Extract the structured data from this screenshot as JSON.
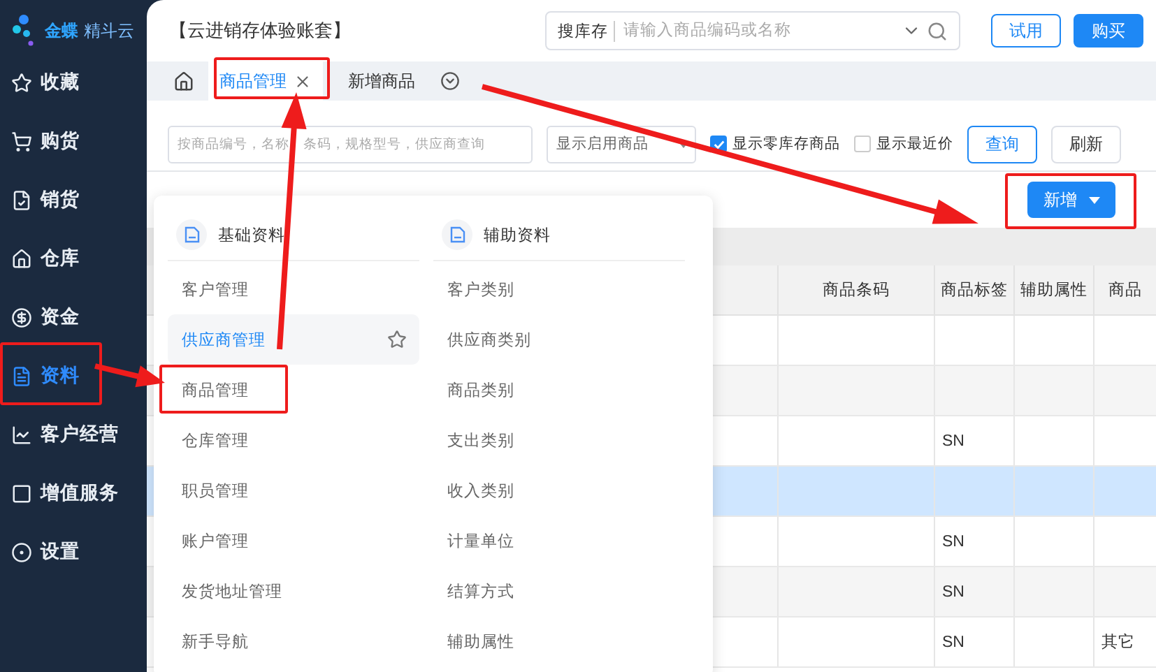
{
  "sidebar": {
    "logo": {
      "brand": "金蝶",
      "product": "精斗云"
    },
    "items": [
      {
        "label": "收藏",
        "selected": false
      },
      {
        "label": "购货",
        "selected": false
      },
      {
        "label": "销货",
        "selected": false
      },
      {
        "label": "仓库",
        "selected": false
      },
      {
        "label": "资金",
        "selected": false
      },
      {
        "label": "资料",
        "selected": true
      },
      {
        "label": "客户经营",
        "selected": false
      },
      {
        "label": "增值服务",
        "selected": false
      },
      {
        "label": "设置",
        "selected": false
      }
    ]
  },
  "header": {
    "title": "【云进销存体验账套】",
    "search": {
      "scope": "搜库存",
      "placeholder": "请输入商品编码或名称"
    },
    "buttons": [
      {
        "label": "试用",
        "kind": "outline"
      },
      {
        "label": "购买",
        "kind": "primary"
      }
    ]
  },
  "tabs": [
    {
      "label": "商品管理",
      "selected": true,
      "closable": true
    },
    {
      "label": "新增商品",
      "selected": false,
      "closable": false
    }
  ],
  "filters": {
    "search_placeholder": "按商品编号，名称　条码，规格型号，供应商查询",
    "status_select": "显示启用商品",
    "checkboxes": [
      {
        "label": "显示零库存商品",
        "checked": true
      },
      {
        "label": "显示最近价",
        "checked": false
      }
    ],
    "buttons": [
      {
        "label": "查询",
        "kind": "outline"
      },
      {
        "label": "刷新",
        "kind": "plain"
      }
    ]
  },
  "add_button": "新增",
  "table": {
    "columns": [
      "商品条码",
      "商品标签",
      "辅助属性",
      "商品"
    ],
    "rows": [
      {
        "cells": [
          "",
          "",
          "",
          ""
        ],
        "selected": false
      },
      {
        "cells": [
          "",
          "",
          "",
          ""
        ],
        "selected": false
      },
      {
        "cells": [
          "",
          "SN",
          "",
          ""
        ],
        "selected": false
      },
      {
        "cells": [
          "",
          "",
          "",
          ""
        ],
        "selected": true
      },
      {
        "cells": [
          "",
          "SN",
          "",
          ""
        ],
        "selected": false
      },
      {
        "cells": [
          "",
          "SN",
          "",
          ""
        ],
        "selected": false
      },
      {
        "cells": [
          "",
          "SN",
          "",
          "其它"
        ],
        "selected": false
      }
    ]
  },
  "menu": {
    "sections": [
      {
        "title": "基础资料",
        "items": [
          {
            "label": "客户管理",
            "hovered": false
          },
          {
            "label": "供应商管理",
            "hovered": true
          },
          {
            "label": "商品管理",
            "hovered": false
          },
          {
            "label": "仓库管理",
            "hovered": false
          },
          {
            "label": "职员管理",
            "hovered": false
          },
          {
            "label": "账户管理",
            "hovered": false
          },
          {
            "label": "发货地址管理",
            "hovered": false
          },
          {
            "label": "新手导航",
            "hovered": false
          }
        ]
      },
      {
        "title": "辅助资料",
        "items": [
          {
            "label": "客户类别",
            "hovered": false
          },
          {
            "label": "供应商类别",
            "hovered": false
          },
          {
            "label": "商品类别",
            "hovered": false
          },
          {
            "label": "支出类别",
            "hovered": false
          },
          {
            "label": "收入类别",
            "hovered": false
          },
          {
            "label": "计量单位",
            "hovered": false
          },
          {
            "label": "结算方式",
            "hovered": false
          },
          {
            "label": "辅助属性",
            "hovered": false
          }
        ]
      }
    ]
  }
}
